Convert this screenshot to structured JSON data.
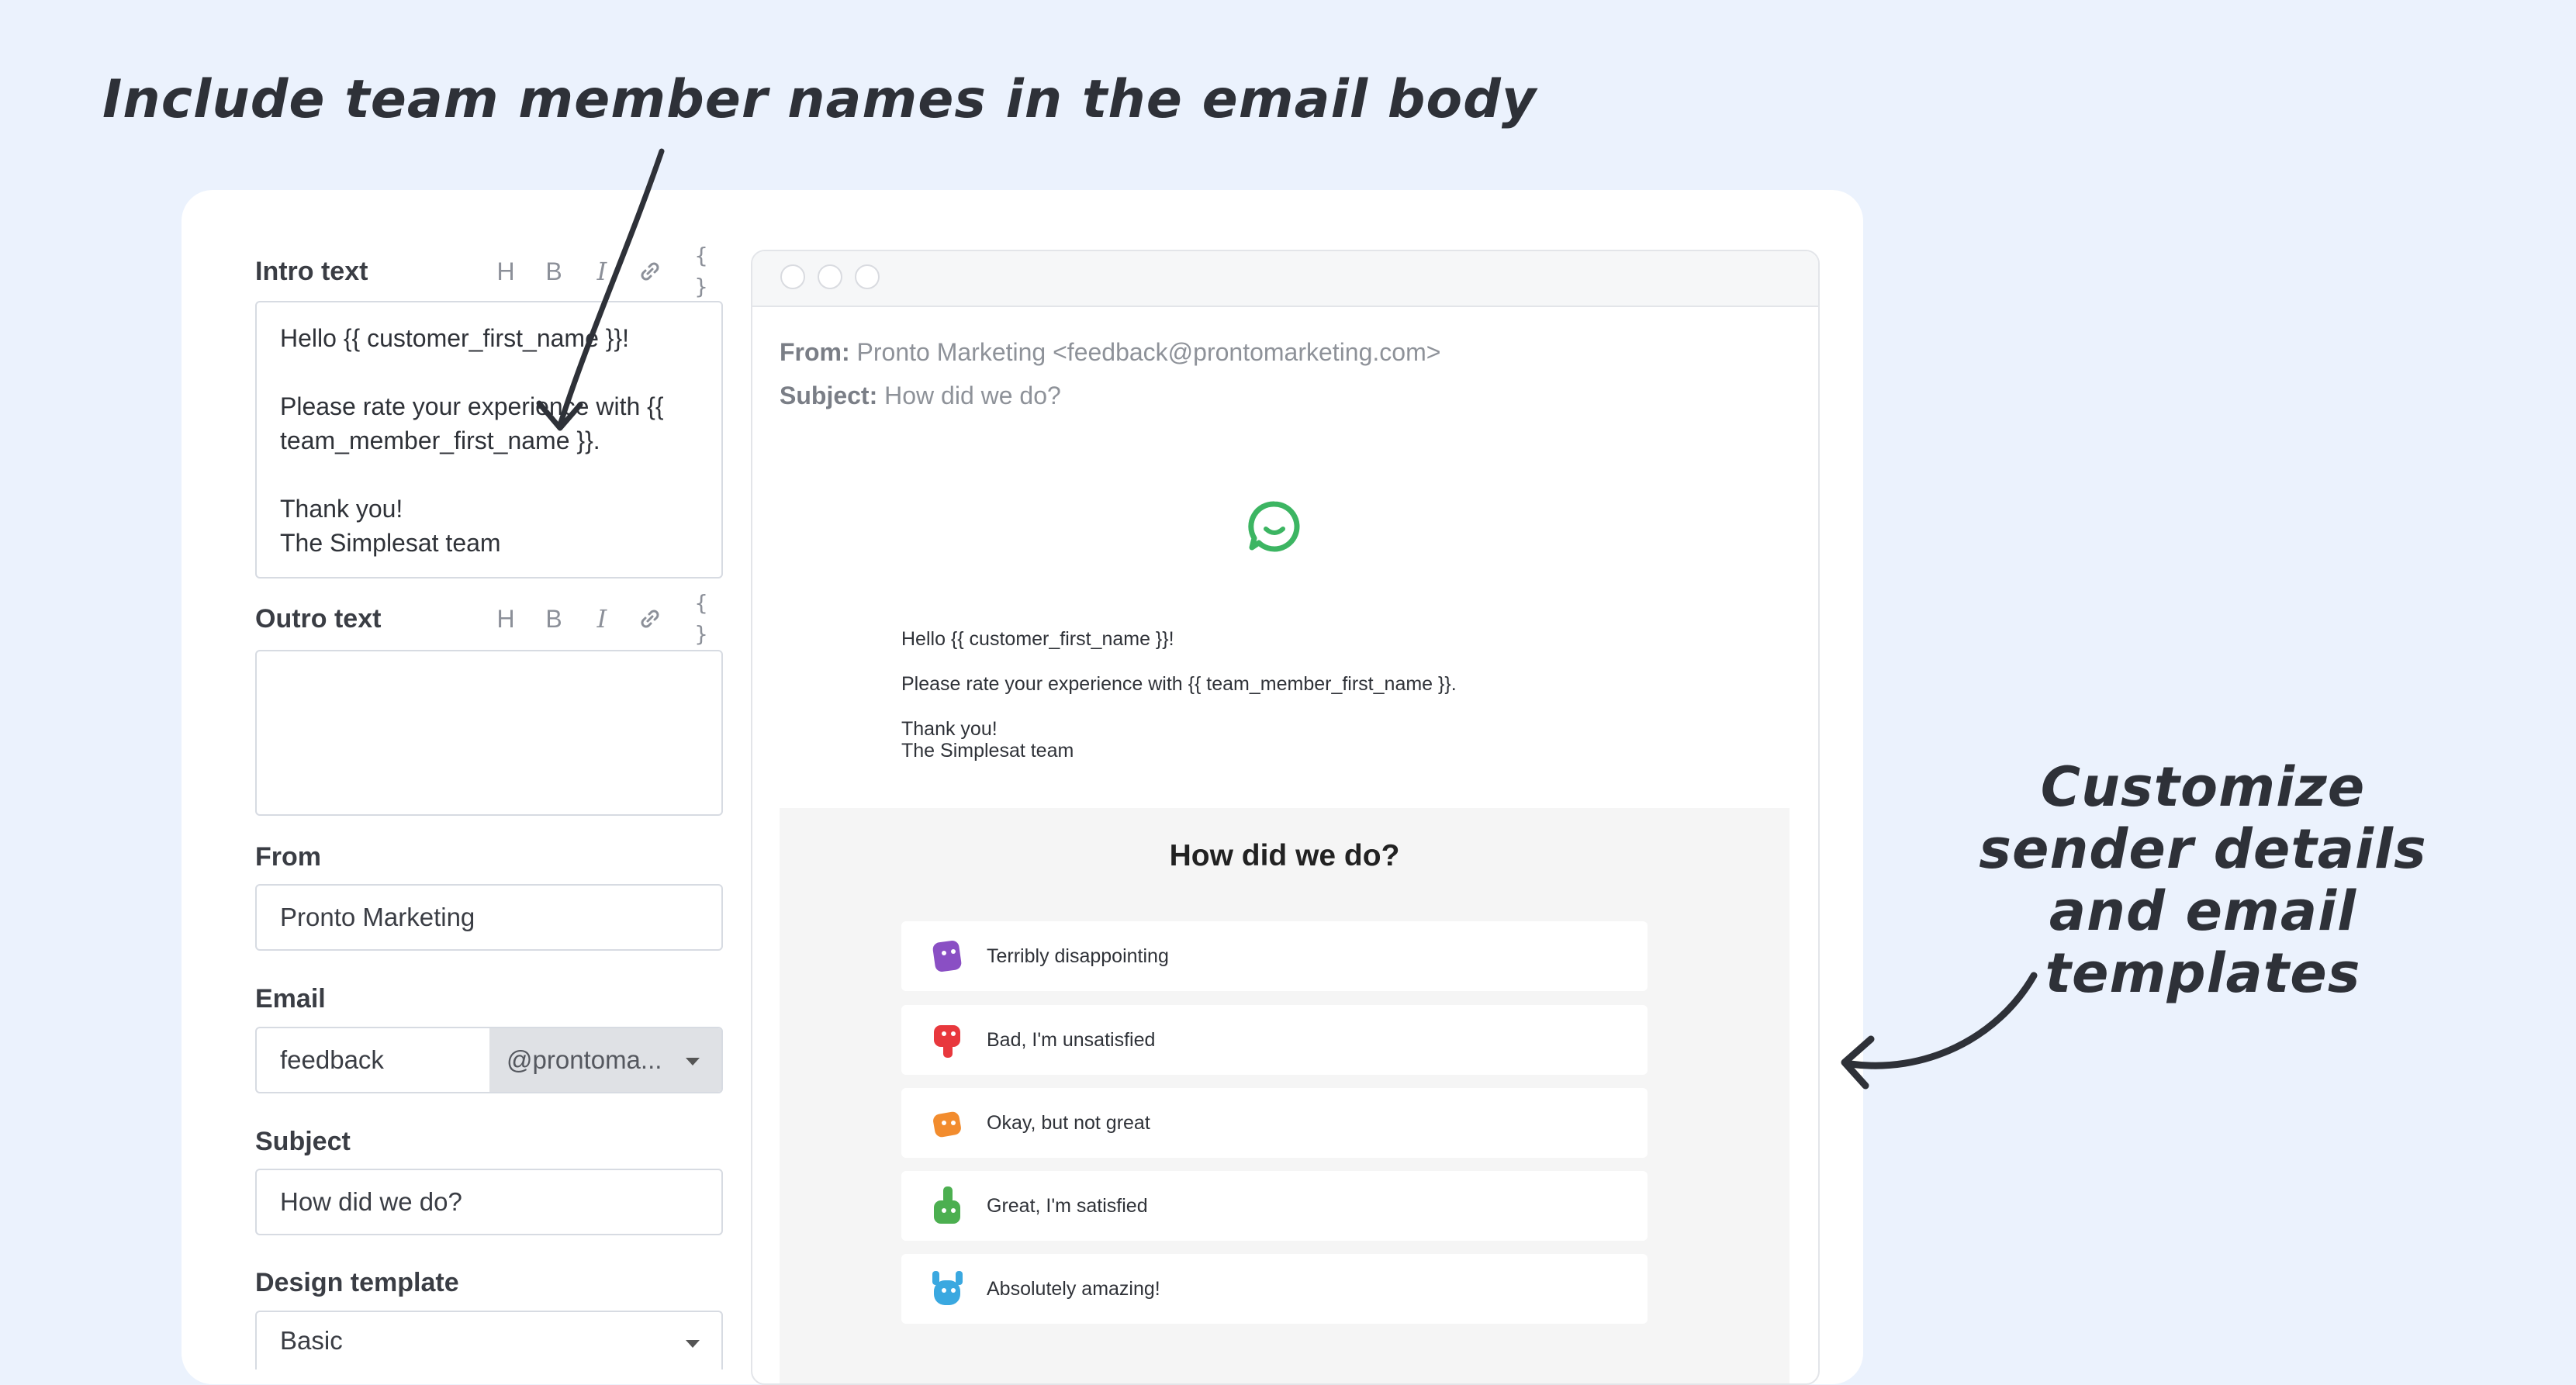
{
  "annotations": {
    "top": "Include team member names in the email body",
    "right": "Customize sender details and email templates"
  },
  "form": {
    "intro": {
      "label": "Intro text",
      "lines": [
        "Hello {{ customer_first_name }}!",
        "",
        "Please rate your experience with {{",
        "team_member_first_name }}.",
        "",
        "Thank you!",
        "The Simplesat team"
      ]
    },
    "outro": {
      "label": "Outro text",
      "value": ""
    },
    "toolbar": {
      "heading": "H",
      "bold": "B",
      "italic": "I",
      "link_icon": "link-icon",
      "code": "{ }"
    },
    "from": {
      "label": "From",
      "value": "Pronto Marketing"
    },
    "email": {
      "label": "Email",
      "local": "feedback",
      "domain": "@prontoma..."
    },
    "subject": {
      "label": "Subject",
      "value": "How did we do?"
    },
    "design_template": {
      "label": "Design template",
      "value": "Basic"
    }
  },
  "preview": {
    "from_label": "From:",
    "from_value": "Pronto Marketing <feedback@prontomarketing.com>",
    "subject_label": "Subject:",
    "subject_value": "How did we do?",
    "logo_color": "#3cb562",
    "body": {
      "greeting": "Hello {{ customer_first_name }}!",
      "request": "Please rate your experience with {{ team_member_first_name }}.",
      "thanks": "Thank you!",
      "signature": "The Simplesat team"
    },
    "survey": {
      "question": "How did we do?",
      "options": [
        {
          "label": "Terribly disappointing",
          "color": "#8a4fc4",
          "icon": "purple-face-icon"
        },
        {
          "label": "Bad, I'm unsatisfied",
          "color": "#e8383d",
          "icon": "thumbs-down-icon"
        },
        {
          "label": "Okay, but not great",
          "color": "#f28c2e",
          "icon": "so-so-hand-icon"
        },
        {
          "label": "Great, I'm satisfied",
          "color": "#4caf50",
          "icon": "thumbs-up-icon"
        },
        {
          "label": "Absolutely amazing!",
          "color": "#3aa8e0",
          "icon": "raised-hands-icon"
        }
      ]
    }
  }
}
